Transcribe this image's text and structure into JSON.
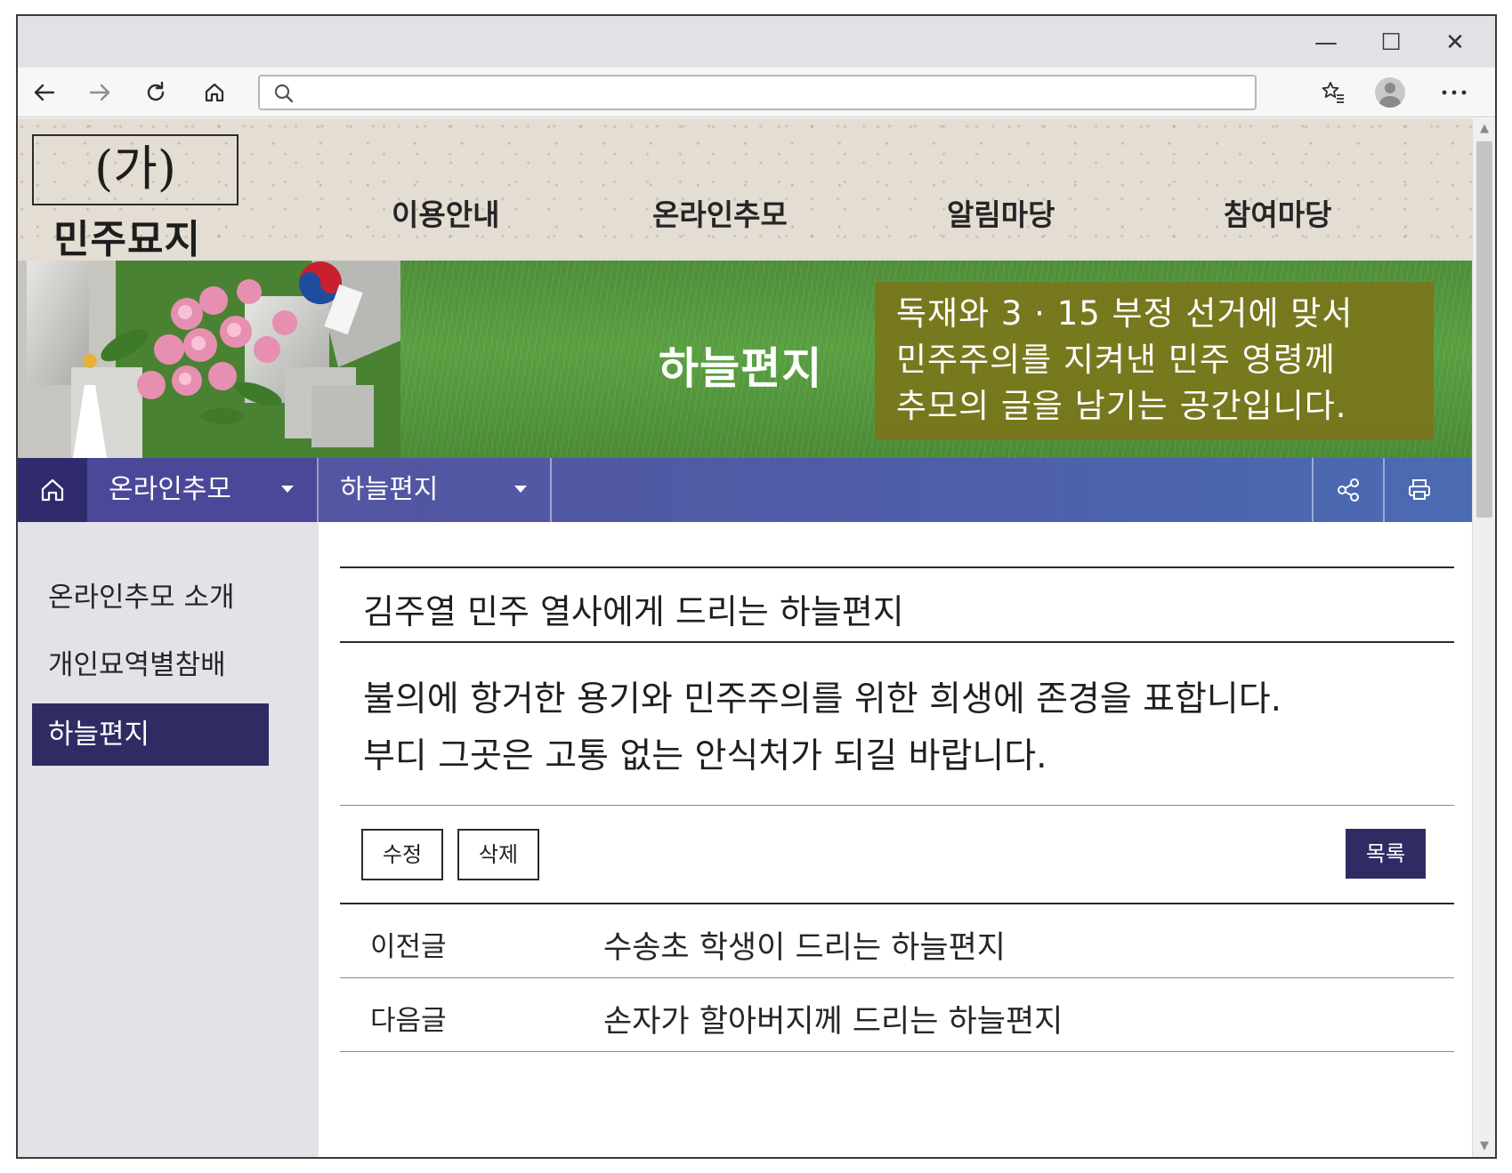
{
  "browser": {
    "window_controls": {
      "minimize": "—",
      "maximize": "☐",
      "close": "✕"
    },
    "address_bar": {
      "value": "",
      "placeholder": ""
    }
  },
  "site": {
    "logo_mark": "(가)",
    "logo_name": "민주묘지",
    "gnb": [
      "이용안내",
      "온라인추모",
      "알림마당",
      "참여마당"
    ]
  },
  "banner": {
    "title": "하늘편지",
    "desc_lines": [
      "독재와 3 · 15 부정 선거에 맞서",
      "민주주의를 지켜낸 민주 영령께",
      "추모의 글을 남기는 공간입니다."
    ]
  },
  "navbar": {
    "depth1": "온라인추모",
    "depth2": "하늘편지"
  },
  "lnb": {
    "items": [
      "온라인추모 소개",
      "개인묘역별참배",
      "하늘편지"
    ],
    "active_index": 2
  },
  "post": {
    "title": "김주열 민주 열사에게 드리는 하늘편지",
    "body_lines": [
      "불의에 항거한 용기와 민주주의를 위한 희생에 존경을 표합니다.",
      "부디 그곳은 고통 없는 안식처가 되길 바랍니다."
    ],
    "buttons": {
      "edit": "수정",
      "delete": "삭제",
      "list": "목록"
    },
    "prev": {
      "label": "이전글",
      "title": "수송초 학생이 드리는 하늘편지"
    },
    "next": {
      "label": "다음글",
      "title": "손자가 할아버지께 드리는 하늘편지"
    }
  },
  "colors": {
    "navbar_accent": "#4f5ba6",
    "active_dark": "#2f2c63",
    "banner_green": "#5aa142",
    "banner_olive": "#7d7319"
  }
}
